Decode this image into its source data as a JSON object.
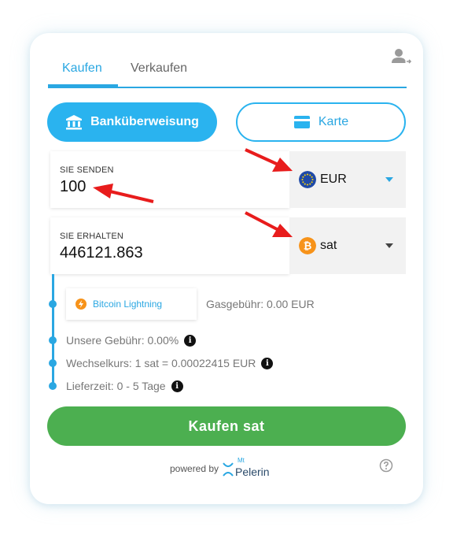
{
  "tabs": [
    {
      "label": "Kaufen",
      "active": true
    },
    {
      "label": "Verkaufen",
      "active": false
    }
  ],
  "payment_methods": {
    "bank": {
      "label": "Banküberweisung",
      "icon": "bank-icon",
      "selected": true
    },
    "card": {
      "label": "Karte",
      "icon": "credit-card-icon",
      "selected": false
    }
  },
  "send": {
    "label": "SIE SENDEN",
    "amount": "100",
    "currency": "EUR",
    "currency_icon": "eur-flag-icon",
    "currency_color": "#1f4aa8"
  },
  "receive": {
    "label": "SIE ERHALTEN",
    "amount": "446121.863",
    "currency": "sat",
    "currency_icon": "bitcoin-icon",
    "currency_color": "#f7931a"
  },
  "network": {
    "label": "Bitcoin Lightning",
    "icon": "lightning-icon"
  },
  "gas_fee": "Gasgebühr: 0.00 EUR",
  "info": {
    "fee": "Unsere Gebühr: 0.00%",
    "rate": "Wechselkurs: 1 sat = 0.00022415 EUR",
    "delivery": "Lieferzeit: 0 - 5 Tage"
  },
  "buy_button": "Kaufen sat",
  "footer": {
    "powered_by": "powered by",
    "logo_prefix": "Mt",
    "logo_name": "Pelerin"
  },
  "colors": {
    "accent": "#2aa7e2",
    "buy_green": "#4caf50",
    "annotation_red": "#e81c1c"
  }
}
